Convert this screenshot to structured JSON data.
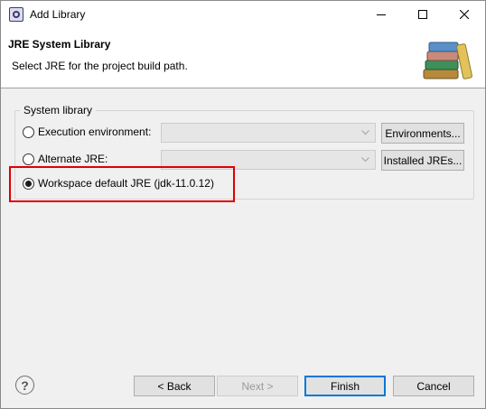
{
  "window": {
    "title": "Add Library"
  },
  "header": {
    "title": "JRE System Library",
    "description": "Select JRE for the project build path."
  },
  "group": {
    "legend": "System library",
    "options": [
      {
        "label": "Execution environment:",
        "checked": false
      },
      {
        "label": "Alternate JRE:",
        "checked": false
      },
      {
        "label": "Workspace default JRE (jdk-11.0.12)",
        "checked": true
      }
    ],
    "execution_environment_value": "",
    "alternate_jre_value": "",
    "environments_button": "Environments...",
    "installed_jres_button": "Installed JREs..."
  },
  "footer": {
    "help_glyph": "?",
    "back_button": "< Back",
    "next_button": "Next >",
    "finish_button": "Finish",
    "cancel_button": "Cancel"
  },
  "colors": {
    "highlight": "#e00000",
    "default_button_border": "#0078d7"
  }
}
